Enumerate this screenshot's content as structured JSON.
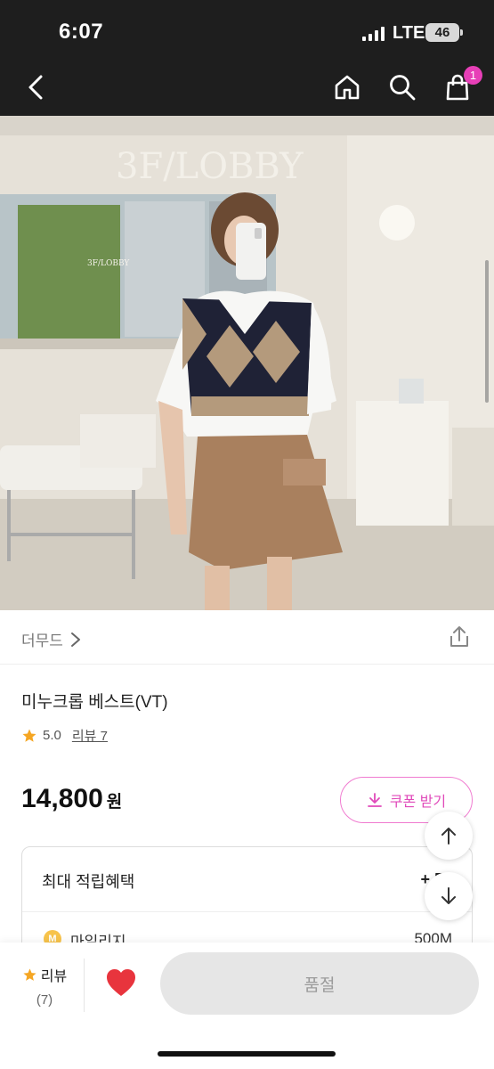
{
  "status": {
    "time": "6:07",
    "network": "LTE",
    "battery": "46"
  },
  "header": {
    "cart_count": "1"
  },
  "photo": {
    "sign_big": "3F/LOBBY",
    "sign_small": "3F/LOBBY"
  },
  "brand": {
    "name": "더무드"
  },
  "product": {
    "title": "미누크롭 베스트(VT)",
    "rating": "5.0",
    "review_link": "리뷰 7",
    "price": "14,800",
    "currency": "원",
    "coupon_label": "쿠폰 받기"
  },
  "benefit": {
    "heading": "최대 적립혜택",
    "amount": "+ 50",
    "mileage_icon": "M",
    "mileage_label": "마일리지",
    "mileage_amount": "500M"
  },
  "bottom": {
    "review_label": "리뷰",
    "review_count": "(7)",
    "buy_label": "품절"
  },
  "colors": {
    "accent": "#e73fb7",
    "heart": "#e8343d",
    "star": "#f5a623"
  }
}
